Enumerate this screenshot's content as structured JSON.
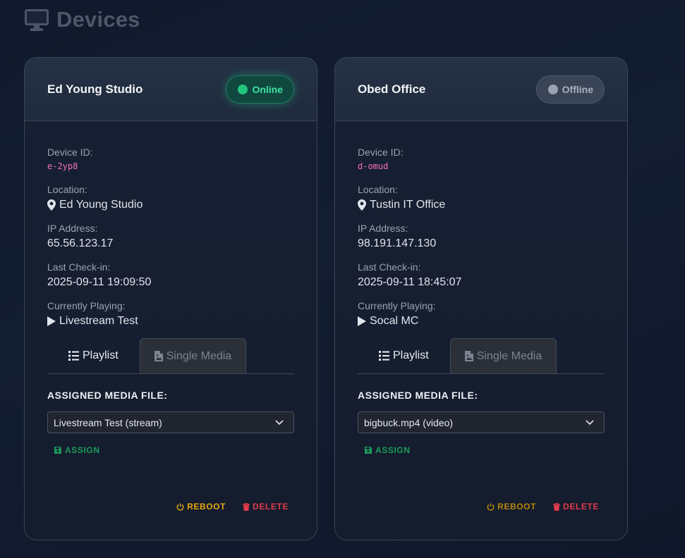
{
  "page": {
    "title": "Devices",
    "icon": "monitor-icon"
  },
  "labels": {
    "device_id": "Device ID:",
    "location": "Location:",
    "ip_address": "IP Address:",
    "last_checkin": "Last Check-in:",
    "currently_playing": "Currently Playing:",
    "tab_playlist": "Playlist",
    "tab_single_media": "Single Media",
    "assigned_media": "ASSIGNED MEDIA FILE:",
    "assign": "ASSIGN",
    "reboot": "REBOOT",
    "delete": "DELETE"
  },
  "devices": [
    {
      "name": "Ed Young Studio",
      "status": "Online",
      "device_id": "e-2yp8",
      "location": "Ed Young Studio",
      "ip_address": "65.56.123.17",
      "last_checkin": "2025-09-11 19:09:50",
      "currently_playing": "Livestream Test",
      "assigned_media": "Livestream Test (stream)"
    },
    {
      "name": "Obed Office",
      "status": "Offline",
      "device_id": "d-omud",
      "location": "Tustin IT Office",
      "ip_address": "98.191.147.130",
      "last_checkin": "2025-09-11 18:45:07",
      "currently_playing": "Socal MC",
      "assigned_media": "bigbuck.mp4 (video)"
    }
  ],
  "colors": {
    "online": "#22c57e",
    "offline": "#9aa2af",
    "device_id": "#f472b6",
    "assign": "#1c9a5c",
    "reboot": "#e5a710",
    "delete": "#e03b4a"
  }
}
